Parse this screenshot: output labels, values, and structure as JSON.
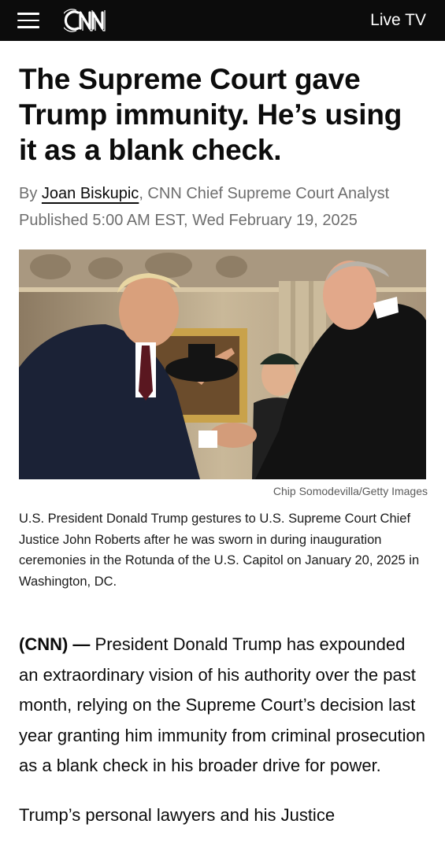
{
  "header": {
    "logo_text": "CNN",
    "live_tv_label": "Live TV",
    "menu_icon": "hamburger-menu-icon"
  },
  "article": {
    "headline": "The Supreme Court gave Trump immunity. He’s using it as a blank check.",
    "byline_prefix": "By ",
    "author": "Joan Biskupic",
    "author_title": ", CNN Chief Supreme Court Analyst",
    "published": "Published 5:00 AM EST, Wed February 19, 2025",
    "image_credit": "Chip Somodevilla/Getty Images",
    "caption": "U.S. President Donald Trump gestures to U.S. Supreme Court Chief Justice John Roberts after he was sworn in during inauguration ceremonies in the Rotunda of the U.S. Capitol on January 20, 2025 in Washington, DC.",
    "dateline": "(CNN) —",
    "paragraph1": " President Donald Trump has expounded an extraordinary vision of his authority over the past month, relying on the Supreme Court’s decision last year granting him immunity from criminal prosecution as a blank check in his broader drive for power.",
    "paragraph2": "Trump’s personal lawyers and his Justice"
  },
  "colors": {
    "topbar_bg": "#0c0c0c",
    "text": "#0c0c0c",
    "meta_gray": "#6e6e6e"
  }
}
